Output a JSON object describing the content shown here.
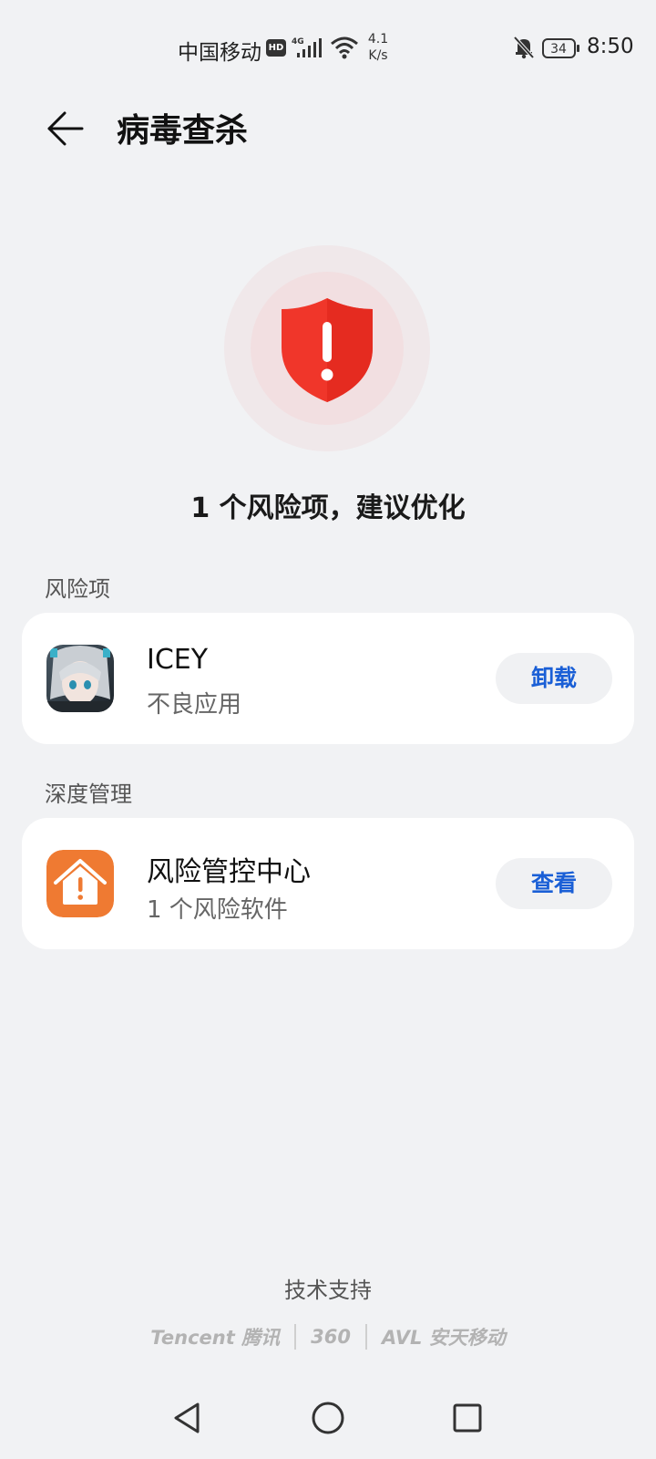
{
  "status_bar": {
    "carrier": "中国移动",
    "hd_badge": "HD",
    "network": "4G",
    "speed_value": "4.1",
    "speed_unit": "K/s",
    "battery": "34",
    "time": "8:50"
  },
  "header": {
    "title": "病毒查杀"
  },
  "hero": {
    "summary": "1 个风险项，建议优化",
    "shield_color": "#f0362a"
  },
  "sections": {
    "risk": {
      "label": "风险项",
      "item": {
        "title": "ICEY",
        "subtitle": "不良应用",
        "action": "卸载"
      }
    },
    "deep": {
      "label": "深度管理",
      "item": {
        "title": "风险管控中心",
        "subtitle": "1 个风险软件",
        "action": "查看",
        "icon_color": "#ef7a32"
      }
    }
  },
  "footer": {
    "support_label": "技术支持",
    "partners": [
      "Tencent 腾讯",
      "360",
      "AVL 安天移动"
    ]
  },
  "colors": {
    "accent": "#1a5fd6",
    "background": "#f1f2f4"
  }
}
